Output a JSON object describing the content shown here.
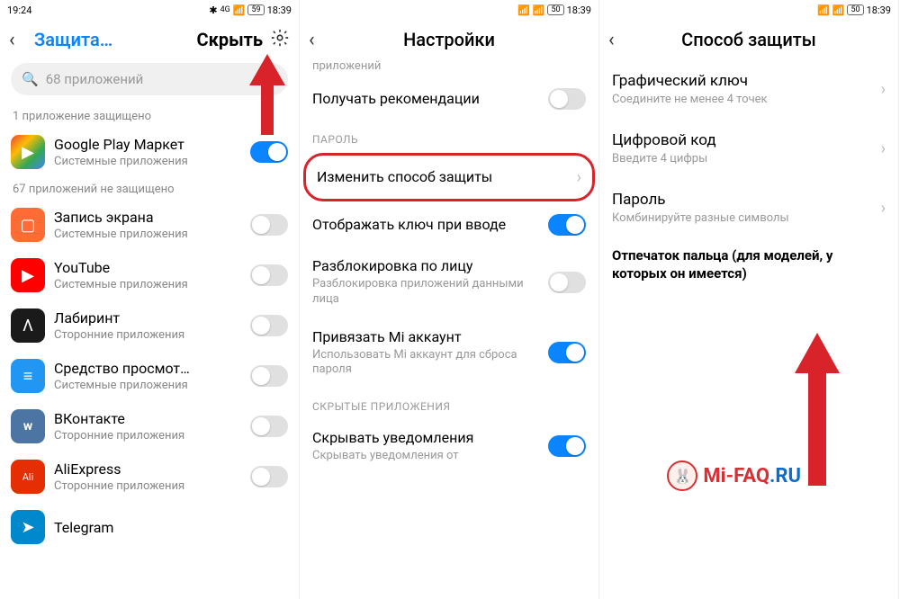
{
  "panel1": {
    "status": {
      "time_left": "19:24",
      "bt": "✱",
      "net": "4G",
      "battery": "59",
      "time_right": "18:39"
    },
    "header": {
      "title": "Защита…",
      "tab2": "Скрыть"
    },
    "search": {
      "placeholder": "68 приложений"
    },
    "protected_label": "1 приложение защищено",
    "unprotected_label": "67 приложений не защищено",
    "apps_protected": [
      {
        "name": "Google Play Маркет",
        "sub": "Системные приложения",
        "on": true,
        "icon": "▶"
      }
    ],
    "apps_unprotected": [
      {
        "name": "Запись экрана",
        "sub": "Системные приложения",
        "on": false,
        "icon": "▢",
        "cls": "ic-rec"
      },
      {
        "name": "YouTube",
        "sub": "Системные приложения",
        "on": false,
        "icon": "▶",
        "cls": "ic-yt"
      },
      {
        "name": "Лабиринт",
        "sub": "Сторонние приложения",
        "on": false,
        "icon": "Λ",
        "cls": "ic-lab"
      },
      {
        "name": "Средство просмот…",
        "sub": "Системные приложения",
        "on": false,
        "icon": "≡",
        "cls": "ic-doc"
      },
      {
        "name": "ВКонтакте",
        "sub": "Сторонние приложения",
        "on": false,
        "icon": "w",
        "cls": "ic-vk"
      },
      {
        "name": "AliExpress",
        "sub": "Сторонние приложения",
        "on": false,
        "icon": "Ali",
        "cls": "ic-ali"
      },
      {
        "name": "Telegram",
        "sub": "",
        "on": false,
        "icon": "➤",
        "cls": "ic-tg"
      }
    ]
  },
  "panel2": {
    "status": {
      "time_right": "18:39",
      "battery": "50"
    },
    "header": {
      "title": "Настройки"
    },
    "top_cut": "приложений",
    "rows": {
      "recs": {
        "title": "Получать рекомендации",
        "on": false
      },
      "section_pass": "ПАРОЛЬ",
      "change": {
        "title": "Изменить способ защиты"
      },
      "showkey": {
        "title": "Отображать ключ при вводе",
        "on": true
      },
      "face": {
        "title": "Разблокировка по лицу",
        "sub": "Разблокировка приложений данными лица",
        "on": false
      },
      "mi": {
        "title": "Привязать Mi аккаунт",
        "sub": "Использовать Mi аккаунт для сброса пароля",
        "on": true
      },
      "section_hidden": "СКРЫТЫЕ ПРИЛОЖЕНИЯ",
      "hide": {
        "title": "Скрывать уведомления",
        "sub": "Скрывать уведомления от",
        "on": true
      }
    }
  },
  "panel3": {
    "status": {
      "time_right": "18:39",
      "battery": "50"
    },
    "header": {
      "title": "Способ защиты"
    },
    "options": [
      {
        "title": "Графический ключ",
        "sub": "Соедините не менее 4 точек"
      },
      {
        "title": "Цифровой код",
        "sub": "Введите 4 цифры"
      },
      {
        "title": "Пароль",
        "sub": "Комбинируйте разные символы"
      }
    ],
    "note": "Отпечаток пальца (для моделей, у которых он имеется)"
  },
  "watermark": {
    "text1": "Mi-FAQ",
    "text2": ".RU"
  }
}
